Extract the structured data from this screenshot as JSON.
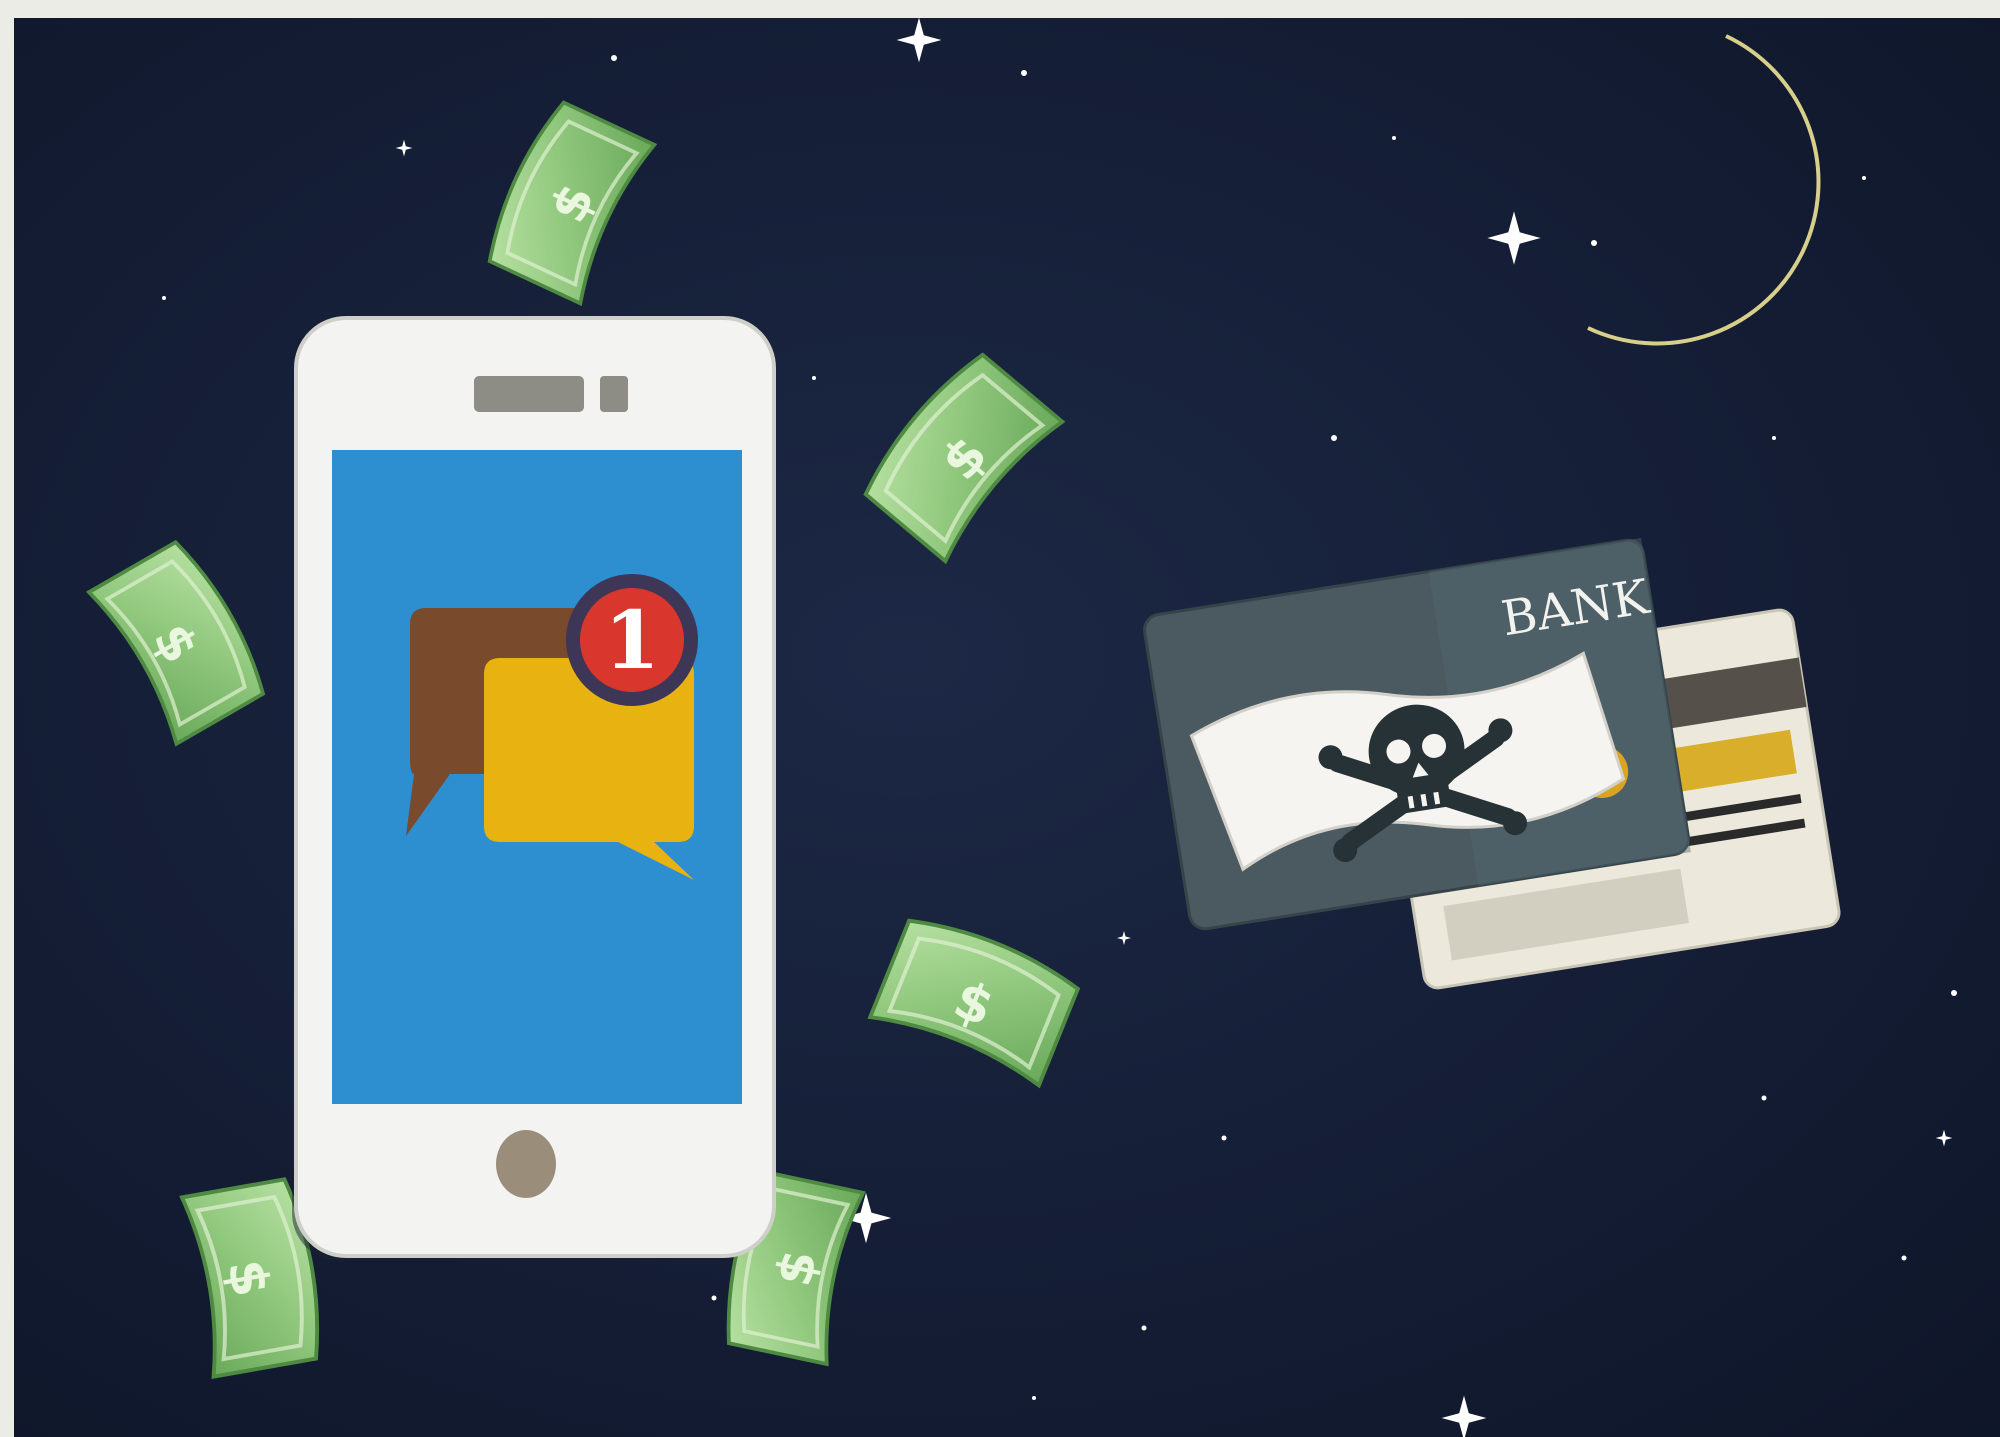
{
  "illustration": {
    "sky_color": "#16203a",
    "moon_color": "#ece8a8",
    "phone": {
      "body_color": "#f3f3f1",
      "screen_color": "#2e8fd0",
      "notification_badge": "1",
      "bubble_back_color": "#7a4a2c",
      "bubble_front_color": "#e8b310",
      "badge_color": "#d9372e",
      "badge_ring_color": "#3e3656"
    },
    "bank_card": {
      "label": "BANK",
      "color": "#4a5a60",
      "flag": "skull-and-crossbones"
    },
    "back_card": {
      "color": "#ece9dc",
      "stripe_color": "#d8ae2a"
    },
    "money_color": "#8fc77c",
    "money_symbol": "$"
  }
}
